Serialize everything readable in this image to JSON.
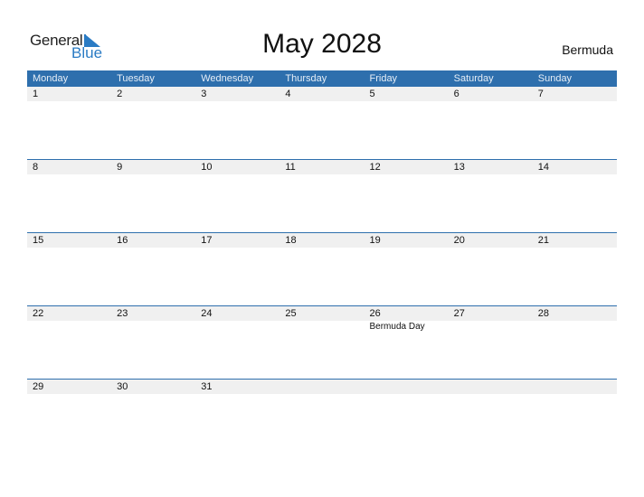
{
  "logo": {
    "word1": "General",
    "word2": "Blue"
  },
  "title": "May 2028",
  "country": "Bermuda",
  "colors": {
    "accent": "#2e6fad",
    "band": "#f0f0f0",
    "logo_blue": "#2a7bc4"
  },
  "weekdays": [
    "Monday",
    "Tuesday",
    "Wednesday",
    "Thursday",
    "Friday",
    "Saturday",
    "Sunday"
  ],
  "weeks": [
    [
      {
        "d": "1",
        "e": ""
      },
      {
        "d": "2",
        "e": ""
      },
      {
        "d": "3",
        "e": ""
      },
      {
        "d": "4",
        "e": ""
      },
      {
        "d": "5",
        "e": ""
      },
      {
        "d": "6",
        "e": ""
      },
      {
        "d": "7",
        "e": ""
      }
    ],
    [
      {
        "d": "8",
        "e": ""
      },
      {
        "d": "9",
        "e": ""
      },
      {
        "d": "10",
        "e": ""
      },
      {
        "d": "11",
        "e": ""
      },
      {
        "d": "12",
        "e": ""
      },
      {
        "d": "13",
        "e": ""
      },
      {
        "d": "14",
        "e": ""
      }
    ],
    [
      {
        "d": "15",
        "e": ""
      },
      {
        "d": "16",
        "e": ""
      },
      {
        "d": "17",
        "e": ""
      },
      {
        "d": "18",
        "e": ""
      },
      {
        "d": "19",
        "e": ""
      },
      {
        "d": "20",
        "e": ""
      },
      {
        "d": "21",
        "e": ""
      }
    ],
    [
      {
        "d": "22",
        "e": ""
      },
      {
        "d": "23",
        "e": ""
      },
      {
        "d": "24",
        "e": ""
      },
      {
        "d": "25",
        "e": ""
      },
      {
        "d": "26",
        "e": "Bermuda Day"
      },
      {
        "d": "27",
        "e": ""
      },
      {
        "d": "28",
        "e": ""
      }
    ],
    [
      {
        "d": "29",
        "e": ""
      },
      {
        "d": "30",
        "e": ""
      },
      {
        "d": "31",
        "e": ""
      },
      {
        "d": "",
        "e": ""
      },
      {
        "d": "",
        "e": ""
      },
      {
        "d": "",
        "e": ""
      },
      {
        "d": "",
        "e": ""
      }
    ]
  ]
}
